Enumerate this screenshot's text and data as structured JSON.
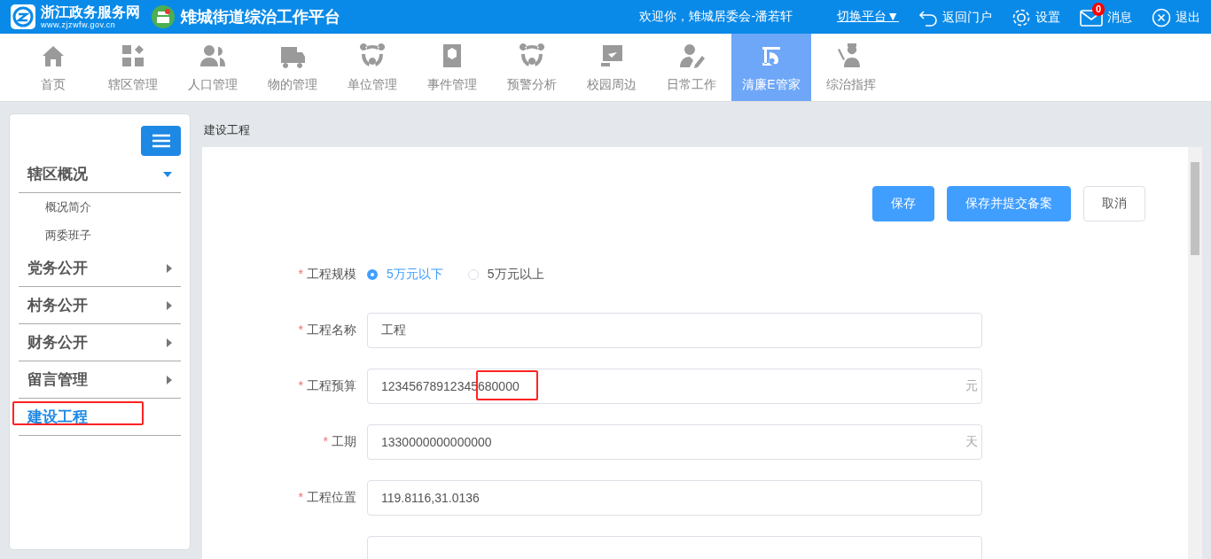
{
  "header": {
    "portal_name": "浙江政务服务网",
    "portal_url": "www.zjzwfw.gov.cn",
    "platform_title": "雉城街道综治工作平台",
    "welcome": "欢迎你，雉城居委会-潘若轩",
    "switch_platform": "切换平台▼",
    "links": [
      {
        "kind": "back",
        "label": "返回门户"
      },
      {
        "kind": "settings",
        "label": "设置"
      },
      {
        "kind": "messages",
        "label": "消息",
        "badge": "0"
      },
      {
        "kind": "logout",
        "label": "退出"
      }
    ]
  },
  "nav": [
    {
      "kind": "home",
      "label": "首页",
      "selected": false
    },
    {
      "kind": "grid",
      "label": "辖区管理",
      "selected": false
    },
    {
      "kind": "people",
      "label": "人口管理",
      "selected": false
    },
    {
      "kind": "truck",
      "label": "物的管理",
      "selected": false
    },
    {
      "kind": "cycle",
      "label": "单位管理",
      "selected": false
    },
    {
      "kind": "book",
      "label": "事件管理",
      "selected": false
    },
    {
      "kind": "cycle",
      "label": "预警分析",
      "selected": false
    },
    {
      "kind": "board",
      "label": "校园周边",
      "selected": false
    },
    {
      "kind": "worker",
      "label": "日常工作",
      "selected": false
    },
    {
      "kind": "building",
      "label": "清廉E管家",
      "selected": true
    },
    {
      "kind": "officer",
      "label": "综治指挥",
      "selected": false
    }
  ],
  "sidebar": [
    {
      "label": "辖区概况",
      "expanded": true,
      "selected": false,
      "children": [
        {
          "label": "概况简介"
        },
        {
          "label": "两委班子"
        }
      ]
    },
    {
      "label": "党务公开",
      "expanded": false,
      "selected": false
    },
    {
      "label": "村务公开",
      "expanded": false,
      "selected": false
    },
    {
      "label": "财务公开",
      "expanded": false,
      "selected": false
    },
    {
      "label": "留言管理",
      "expanded": false,
      "selected": false
    },
    {
      "label": "建设工程",
      "selected": true
    }
  ],
  "breadcrumb": "建设工程",
  "buttons": [
    {
      "kind": "primary",
      "label": "保存"
    },
    {
      "kind": "primary",
      "label": "保存并提交备案"
    },
    {
      "kind": "default",
      "label": "取消"
    }
  ],
  "form": [
    {
      "kind": "radio",
      "marker": "*",
      "label": "工程规模",
      "options": [
        {
          "label": "5万元以下",
          "selected": true
        },
        {
          "label": "5万元以上",
          "selected": false
        }
      ]
    },
    {
      "kind": "text",
      "marker": "*",
      "label": "工程名称",
      "value": "工程"
    },
    {
      "kind": "text",
      "marker": "*",
      "label": "工程预算",
      "value": "12345678912345680000",
      "unit": "元"
    },
    {
      "kind": "text",
      "marker": "*",
      "label": "工期",
      "value": "1330000000000000",
      "unit": "天"
    },
    {
      "kind": "text",
      "marker": "*",
      "label": "工程位置",
      "value": "119.8116,31.0136"
    },
    {
      "kind": "text"
    }
  ]
}
